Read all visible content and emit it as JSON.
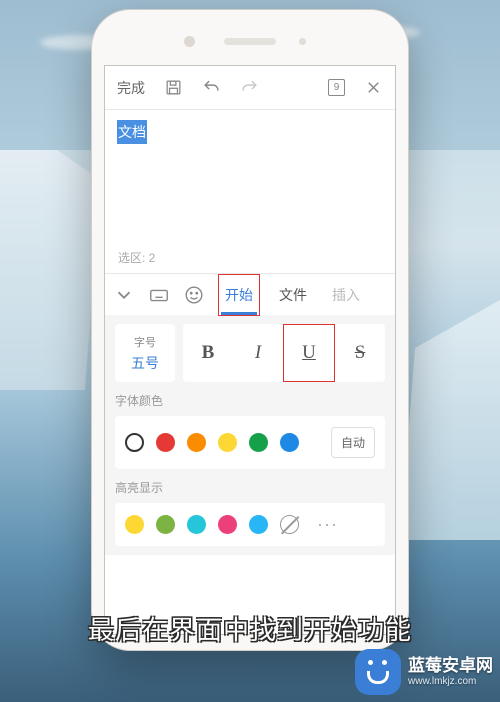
{
  "topbar": {
    "done": "完成",
    "page_num": "9"
  },
  "doc": {
    "selected_text": "文档",
    "selection_info": "选区: 2"
  },
  "tabs": {
    "start": "开始",
    "file": "文件",
    "insert": "插入"
  },
  "font_size": {
    "label": "字号",
    "value": "五号"
  },
  "format": {
    "bold": "B",
    "italic": "I",
    "underline": "U",
    "strike": "S"
  },
  "sections": {
    "font_color": "字体颜色",
    "highlight": "高亮显示",
    "auto": "自动"
  },
  "colors": {
    "c1": "#333333",
    "c2": "#e53935",
    "c3": "#fb8c00",
    "c4": "#fdd835",
    "c5": "#16a04a",
    "c6": "#1e88e5"
  },
  "highlights": {
    "h1": "#fdd835",
    "h2": "#7cb342",
    "h3": "#26c6da",
    "h4": "#ec407a",
    "h5": "#29b6f6"
  },
  "caption": "最后在界面中找到开始功能",
  "watermark": {
    "name": "蓝莓安卓网",
    "url": "www.lmkjz.com"
  }
}
